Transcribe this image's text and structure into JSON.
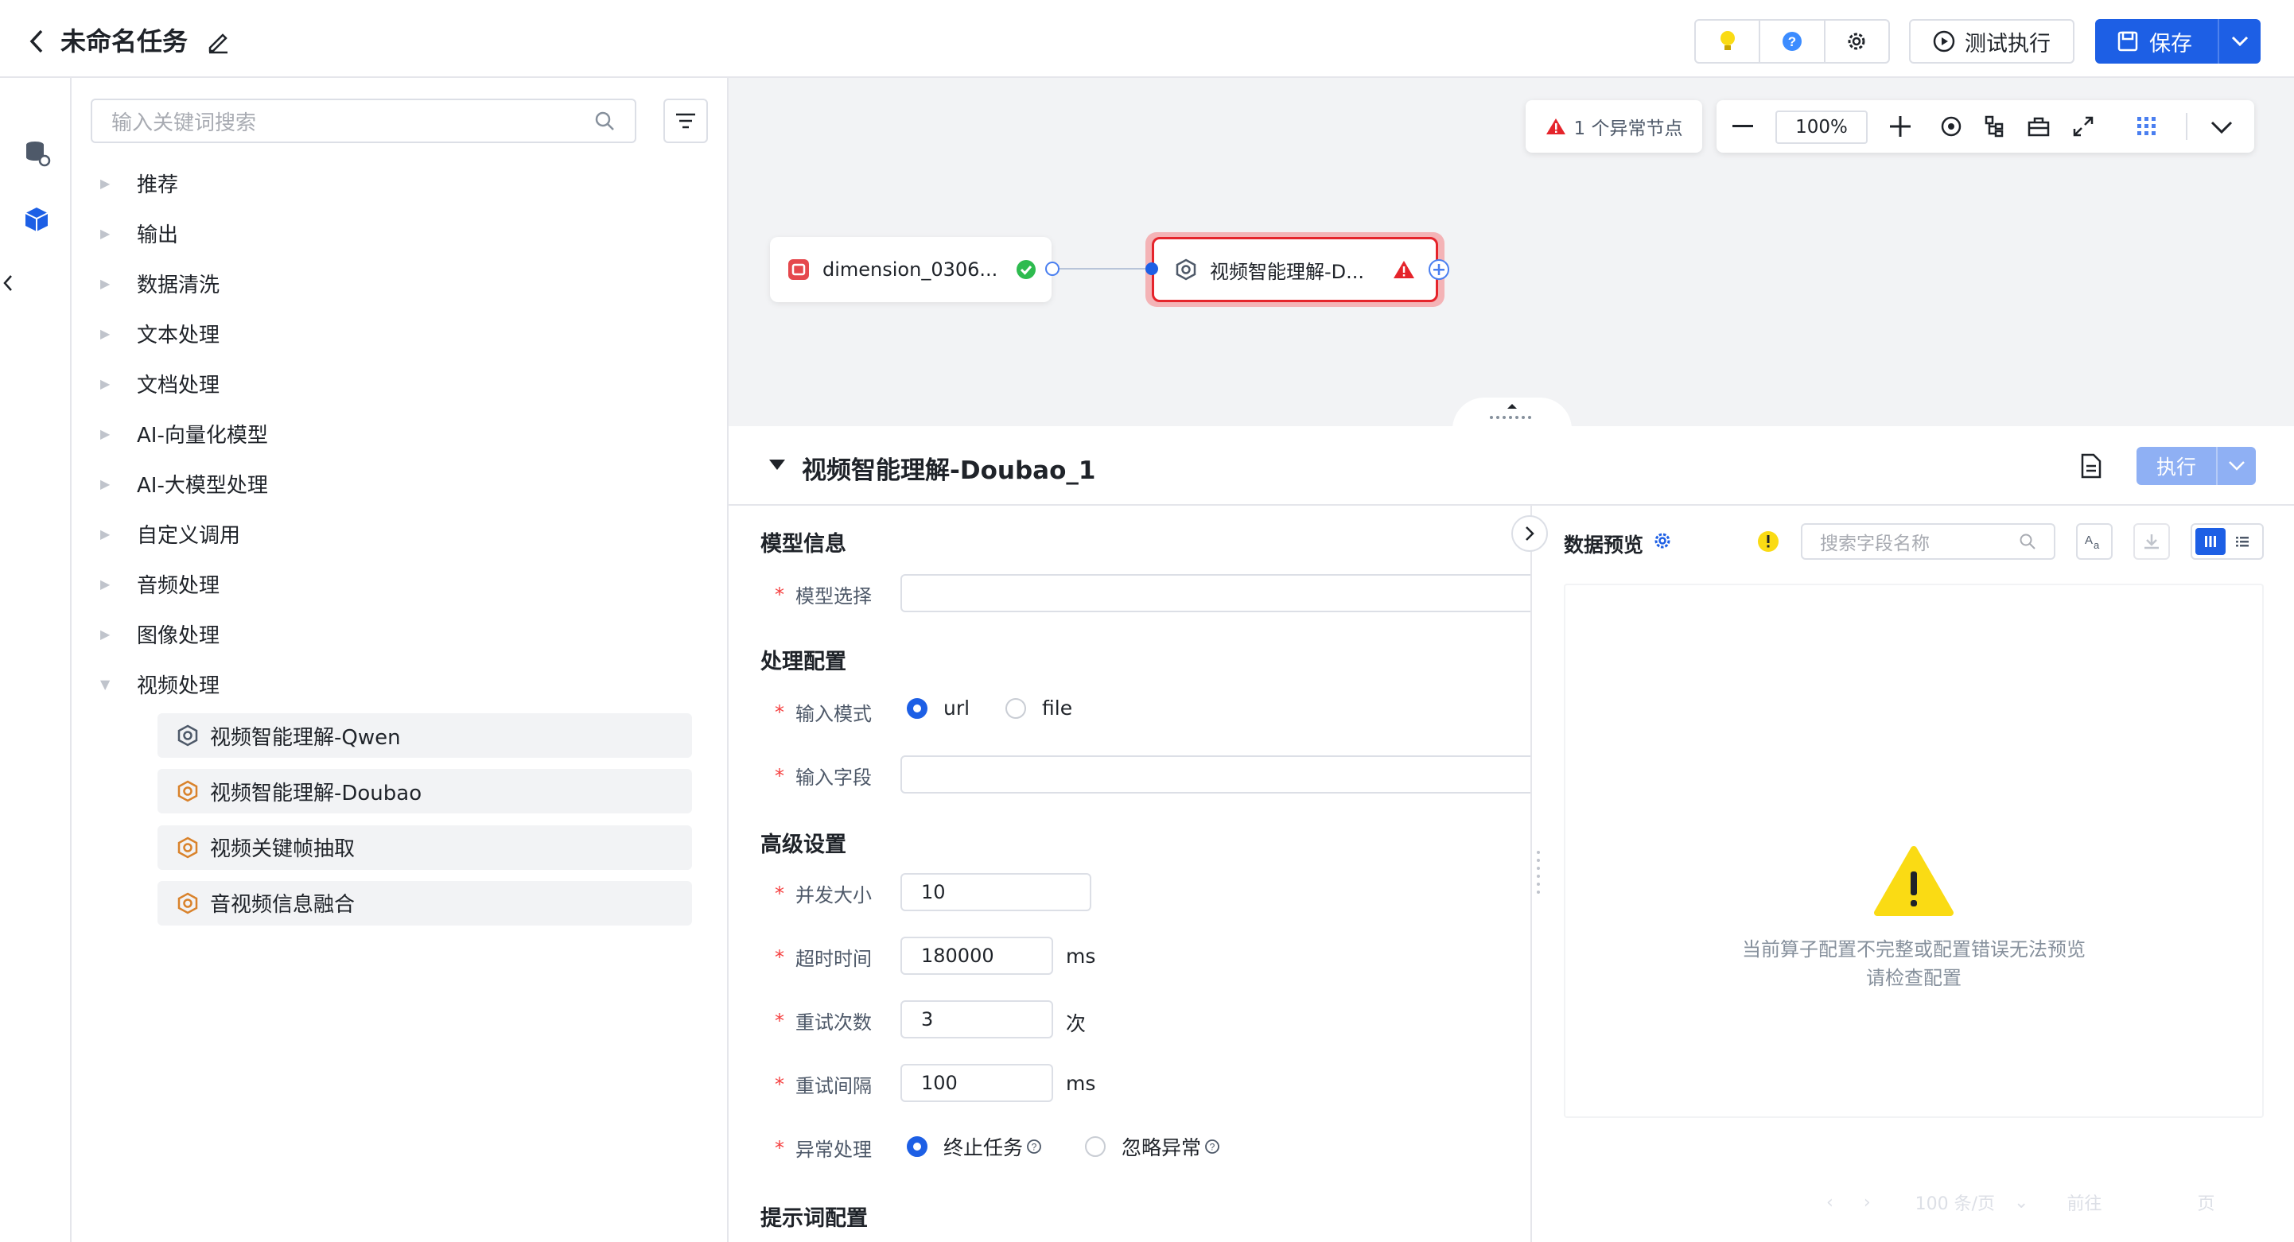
{
  "header": {
    "title": "未命名任务",
    "test_run_label": "测试执行",
    "save_label": "保存"
  },
  "sidebar": {
    "search_placeholder": "输入关键词搜索",
    "categories": [
      {
        "label": "推荐"
      },
      {
        "label": "输出"
      },
      {
        "label": "数据清洗"
      },
      {
        "label": "文本处理"
      },
      {
        "label": "文档处理"
      },
      {
        "label": "AI-向量化模型"
      },
      {
        "label": "AI-大模型处理"
      },
      {
        "label": "自定义调用"
      },
      {
        "label": "音频处理"
      },
      {
        "label": "图像处理"
      },
      {
        "label": "视频处理"
      }
    ],
    "video_items": [
      {
        "label": "视频智能理解-Qwen"
      },
      {
        "label": "视频智能理解-Doubao"
      },
      {
        "label": "视频关键帧抽取"
      },
      {
        "label": "音视频信息融合"
      }
    ]
  },
  "canvas": {
    "anomaly_text": "1 个异常节点",
    "zoom": "100%",
    "node1_label": "dimension_0306...",
    "node2_label": "视频智能理解-D..."
  },
  "detail": {
    "title": "视频智能理解-Doubao_1",
    "run_label": "执行",
    "model_section": "模型信息",
    "model_select_label": "模型选择",
    "process_section": "处理配置",
    "input_mode_label": "输入模式",
    "input_mode_options": [
      "url",
      "file"
    ],
    "input_field_label": "输入字段",
    "advanced_section": "高级设置",
    "concurrency_label": "并发大小",
    "concurrency_value": "10",
    "timeout_label": "超时时间",
    "timeout_value": "180000",
    "timeout_unit": "ms",
    "retry_label": "重试次数",
    "retry_value": "3",
    "retry_unit": "次",
    "interval_label": "重试间隔",
    "interval_value": "100",
    "interval_unit": "ms",
    "error_label": "异常处理",
    "error_options": [
      "终止任务",
      "忽略异常"
    ],
    "prompt_section": "提示词配置"
  },
  "preview": {
    "title": "数据预览",
    "search_placeholder": "搜索字段名称",
    "empty_line1": "当前算子配置不完整或配置错误无法预览",
    "empty_line2": "请检查配置",
    "page_size": "100 条/页",
    "goto_label": "前往",
    "page_unit": "页"
  },
  "colors": {
    "primary": "#1d5fe5",
    "error": "#e5242b",
    "success": "#2ebb4f",
    "warning": "#fadb14"
  }
}
